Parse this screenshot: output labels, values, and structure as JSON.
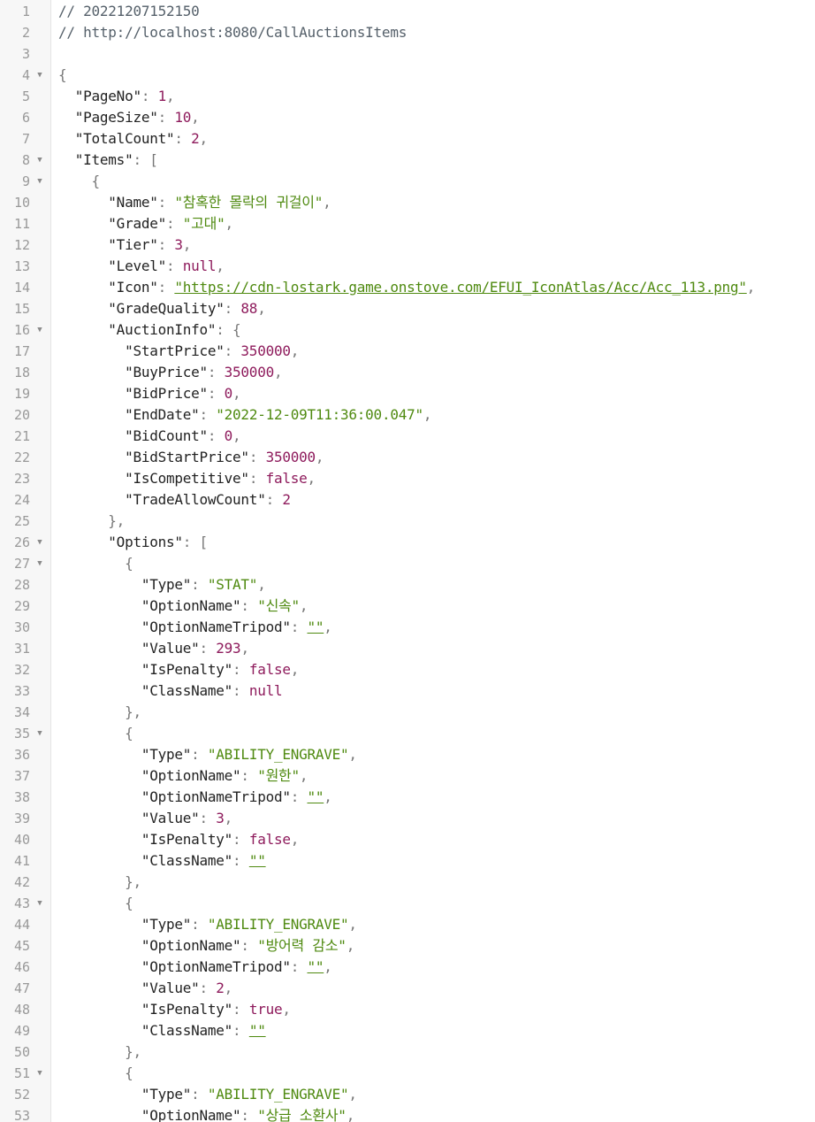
{
  "accent_colors": {
    "string": "#4f8a10",
    "number": "#8e1b5c",
    "keyword": "#8e1b5c",
    "key": "#222222",
    "punct": "#777777",
    "comment": "#55606a"
  },
  "fold_icon": "triangle-down-icon",
  "lines": [
    {
      "n": "1",
      "fold": false,
      "t": [
        {
          "c": "c",
          "v": "// 20221207152150"
        }
      ]
    },
    {
      "n": "2",
      "fold": false,
      "t": [
        {
          "c": "c",
          "v": "// http://localhost:8080/CallAuctionsItems"
        }
      ]
    },
    {
      "n": "3",
      "fold": false,
      "t": []
    },
    {
      "n": "4",
      "fold": true,
      "t": [
        {
          "c": "p",
          "v": "{"
        }
      ]
    },
    {
      "n": "5",
      "fold": false,
      "t": [
        {
          "c": "k",
          "v": "  \"PageNo\""
        },
        {
          "c": "p",
          "v": ": "
        },
        {
          "c": "n",
          "v": "1"
        },
        {
          "c": "p",
          "v": ","
        }
      ]
    },
    {
      "n": "6",
      "fold": false,
      "t": [
        {
          "c": "k",
          "v": "  \"PageSize\""
        },
        {
          "c": "p",
          "v": ": "
        },
        {
          "c": "n",
          "v": "10"
        },
        {
          "c": "p",
          "v": ","
        }
      ]
    },
    {
      "n": "7",
      "fold": false,
      "t": [
        {
          "c": "k",
          "v": "  \"TotalCount\""
        },
        {
          "c": "p",
          "v": ": "
        },
        {
          "c": "n",
          "v": "2"
        },
        {
          "c": "p",
          "v": ","
        }
      ]
    },
    {
      "n": "8",
      "fold": true,
      "t": [
        {
          "c": "k",
          "v": "  \"Items\""
        },
        {
          "c": "p",
          "v": ": ["
        }
      ]
    },
    {
      "n": "9",
      "fold": true,
      "t": [
        {
          "c": "p",
          "v": "    {"
        }
      ]
    },
    {
      "n": "10",
      "fold": false,
      "t": [
        {
          "c": "k",
          "v": "      \"Name\""
        },
        {
          "c": "p",
          "v": ": "
        },
        {
          "c": "s",
          "v": "\"참혹한 몰락의 귀걸이\""
        },
        {
          "c": "p",
          "v": ","
        }
      ]
    },
    {
      "n": "11",
      "fold": false,
      "t": [
        {
          "c": "k",
          "v": "      \"Grade\""
        },
        {
          "c": "p",
          "v": ": "
        },
        {
          "c": "s",
          "v": "\"고대\""
        },
        {
          "c": "p",
          "v": ","
        }
      ]
    },
    {
      "n": "12",
      "fold": false,
      "t": [
        {
          "c": "k",
          "v": "      \"Tier\""
        },
        {
          "c": "p",
          "v": ": "
        },
        {
          "c": "n",
          "v": "3"
        },
        {
          "c": "p",
          "v": ","
        }
      ]
    },
    {
      "n": "13",
      "fold": false,
      "t": [
        {
          "c": "k",
          "v": "      \"Level\""
        },
        {
          "c": "p",
          "v": ": "
        },
        {
          "c": "kw",
          "v": "null"
        },
        {
          "c": "p",
          "v": ","
        }
      ]
    },
    {
      "n": "14",
      "fold": false,
      "t": [
        {
          "c": "k",
          "v": "      \"Icon\""
        },
        {
          "c": "p",
          "v": ": "
        },
        {
          "c": "u",
          "v": "\"https://cdn-lostark.game.onstove.com/EFUI_IconAtlas/Acc/Acc_113.png\""
        },
        {
          "c": "p",
          "v": ","
        }
      ]
    },
    {
      "n": "15",
      "fold": false,
      "t": [
        {
          "c": "k",
          "v": "      \"GradeQuality\""
        },
        {
          "c": "p",
          "v": ": "
        },
        {
          "c": "n",
          "v": "88"
        },
        {
          "c": "p",
          "v": ","
        }
      ]
    },
    {
      "n": "16",
      "fold": true,
      "t": [
        {
          "c": "k",
          "v": "      \"AuctionInfo\""
        },
        {
          "c": "p",
          "v": ": {"
        }
      ]
    },
    {
      "n": "17",
      "fold": false,
      "t": [
        {
          "c": "k",
          "v": "        \"StartPrice\""
        },
        {
          "c": "p",
          "v": ": "
        },
        {
          "c": "n",
          "v": "350000"
        },
        {
          "c": "p",
          "v": ","
        }
      ]
    },
    {
      "n": "18",
      "fold": false,
      "t": [
        {
          "c": "k",
          "v": "        \"BuyPrice\""
        },
        {
          "c": "p",
          "v": ": "
        },
        {
          "c": "n",
          "v": "350000"
        },
        {
          "c": "p",
          "v": ","
        }
      ]
    },
    {
      "n": "19",
      "fold": false,
      "t": [
        {
          "c": "k",
          "v": "        \"BidPrice\""
        },
        {
          "c": "p",
          "v": ": "
        },
        {
          "c": "n",
          "v": "0"
        },
        {
          "c": "p",
          "v": ","
        }
      ]
    },
    {
      "n": "20",
      "fold": false,
      "t": [
        {
          "c": "k",
          "v": "        \"EndDate\""
        },
        {
          "c": "p",
          "v": ": "
        },
        {
          "c": "s",
          "v": "\"2022-12-09T11:36:00.047\""
        },
        {
          "c": "p",
          "v": ","
        }
      ]
    },
    {
      "n": "21",
      "fold": false,
      "t": [
        {
          "c": "k",
          "v": "        \"BidCount\""
        },
        {
          "c": "p",
          "v": ": "
        },
        {
          "c": "n",
          "v": "0"
        },
        {
          "c": "p",
          "v": ","
        }
      ]
    },
    {
      "n": "22",
      "fold": false,
      "t": [
        {
          "c": "k",
          "v": "        \"BidStartPrice\""
        },
        {
          "c": "p",
          "v": ": "
        },
        {
          "c": "n",
          "v": "350000"
        },
        {
          "c": "p",
          "v": ","
        }
      ]
    },
    {
      "n": "23",
      "fold": false,
      "t": [
        {
          "c": "k",
          "v": "        \"IsCompetitive\""
        },
        {
          "c": "p",
          "v": ": "
        },
        {
          "c": "kw",
          "v": "false"
        },
        {
          "c": "p",
          "v": ","
        }
      ]
    },
    {
      "n": "24",
      "fold": false,
      "t": [
        {
          "c": "k",
          "v": "        \"TradeAllowCount\""
        },
        {
          "c": "p",
          "v": ": "
        },
        {
          "c": "n",
          "v": "2"
        }
      ]
    },
    {
      "n": "25",
      "fold": false,
      "t": [
        {
          "c": "p",
          "v": "      },"
        }
      ]
    },
    {
      "n": "26",
      "fold": true,
      "t": [
        {
          "c": "k",
          "v": "      \"Options\""
        },
        {
          "c": "p",
          "v": ": ["
        }
      ]
    },
    {
      "n": "27",
      "fold": true,
      "t": [
        {
          "c": "p",
          "v": "        {"
        }
      ]
    },
    {
      "n": "28",
      "fold": false,
      "t": [
        {
          "c": "k",
          "v": "          \"Type\""
        },
        {
          "c": "p",
          "v": ": "
        },
        {
          "c": "s",
          "v": "\"STAT\""
        },
        {
          "c": "p",
          "v": ","
        }
      ]
    },
    {
      "n": "29",
      "fold": false,
      "t": [
        {
          "c": "k",
          "v": "          \"OptionName\""
        },
        {
          "c": "p",
          "v": ": "
        },
        {
          "c": "s",
          "v": "\"신속\""
        },
        {
          "c": "p",
          "v": ","
        }
      ]
    },
    {
      "n": "30",
      "fold": false,
      "t": [
        {
          "c": "k",
          "v": "          \"OptionNameTripod\""
        },
        {
          "c": "p",
          "v": ": "
        },
        {
          "c": "u",
          "v": "\"\""
        },
        {
          "c": "p",
          "v": ","
        }
      ]
    },
    {
      "n": "31",
      "fold": false,
      "t": [
        {
          "c": "k",
          "v": "          \"Value\""
        },
        {
          "c": "p",
          "v": ": "
        },
        {
          "c": "n",
          "v": "293"
        },
        {
          "c": "p",
          "v": ","
        }
      ]
    },
    {
      "n": "32",
      "fold": false,
      "t": [
        {
          "c": "k",
          "v": "          \"IsPenalty\""
        },
        {
          "c": "p",
          "v": ": "
        },
        {
          "c": "kw",
          "v": "false"
        },
        {
          "c": "p",
          "v": ","
        }
      ]
    },
    {
      "n": "33",
      "fold": false,
      "t": [
        {
          "c": "k",
          "v": "          \"ClassName\""
        },
        {
          "c": "p",
          "v": ": "
        },
        {
          "c": "kw",
          "v": "null"
        }
      ]
    },
    {
      "n": "34",
      "fold": false,
      "t": [
        {
          "c": "p",
          "v": "        },"
        }
      ]
    },
    {
      "n": "35",
      "fold": true,
      "t": [
        {
          "c": "p",
          "v": "        {"
        }
      ]
    },
    {
      "n": "36",
      "fold": false,
      "t": [
        {
          "c": "k",
          "v": "          \"Type\""
        },
        {
          "c": "p",
          "v": ": "
        },
        {
          "c": "s",
          "v": "\"ABILITY_ENGRAVE\""
        },
        {
          "c": "p",
          "v": ","
        }
      ]
    },
    {
      "n": "37",
      "fold": false,
      "t": [
        {
          "c": "k",
          "v": "          \"OptionName\""
        },
        {
          "c": "p",
          "v": ": "
        },
        {
          "c": "s",
          "v": "\"원한\""
        },
        {
          "c": "p",
          "v": ","
        }
      ]
    },
    {
      "n": "38",
      "fold": false,
      "t": [
        {
          "c": "k",
          "v": "          \"OptionNameTripod\""
        },
        {
          "c": "p",
          "v": ": "
        },
        {
          "c": "u",
          "v": "\"\""
        },
        {
          "c": "p",
          "v": ","
        }
      ]
    },
    {
      "n": "39",
      "fold": false,
      "t": [
        {
          "c": "k",
          "v": "          \"Value\""
        },
        {
          "c": "p",
          "v": ": "
        },
        {
          "c": "n",
          "v": "3"
        },
        {
          "c": "p",
          "v": ","
        }
      ]
    },
    {
      "n": "40",
      "fold": false,
      "t": [
        {
          "c": "k",
          "v": "          \"IsPenalty\""
        },
        {
          "c": "p",
          "v": ": "
        },
        {
          "c": "kw",
          "v": "false"
        },
        {
          "c": "p",
          "v": ","
        }
      ]
    },
    {
      "n": "41",
      "fold": false,
      "t": [
        {
          "c": "k",
          "v": "          \"ClassName\""
        },
        {
          "c": "p",
          "v": ": "
        },
        {
          "c": "u",
          "v": "\"\""
        }
      ]
    },
    {
      "n": "42",
      "fold": false,
      "t": [
        {
          "c": "p",
          "v": "        },"
        }
      ]
    },
    {
      "n": "43",
      "fold": true,
      "t": [
        {
          "c": "p",
          "v": "        {"
        }
      ]
    },
    {
      "n": "44",
      "fold": false,
      "t": [
        {
          "c": "k",
          "v": "          \"Type\""
        },
        {
          "c": "p",
          "v": ": "
        },
        {
          "c": "s",
          "v": "\"ABILITY_ENGRAVE\""
        },
        {
          "c": "p",
          "v": ","
        }
      ]
    },
    {
      "n": "45",
      "fold": false,
      "t": [
        {
          "c": "k",
          "v": "          \"OptionName\""
        },
        {
          "c": "p",
          "v": ": "
        },
        {
          "c": "s",
          "v": "\"방어력 감소\""
        },
        {
          "c": "p",
          "v": ","
        }
      ]
    },
    {
      "n": "46",
      "fold": false,
      "t": [
        {
          "c": "k",
          "v": "          \"OptionNameTripod\""
        },
        {
          "c": "p",
          "v": ": "
        },
        {
          "c": "u",
          "v": "\"\""
        },
        {
          "c": "p",
          "v": ","
        }
      ]
    },
    {
      "n": "47",
      "fold": false,
      "t": [
        {
          "c": "k",
          "v": "          \"Value\""
        },
        {
          "c": "p",
          "v": ": "
        },
        {
          "c": "n",
          "v": "2"
        },
        {
          "c": "p",
          "v": ","
        }
      ]
    },
    {
      "n": "48",
      "fold": false,
      "t": [
        {
          "c": "k",
          "v": "          \"IsPenalty\""
        },
        {
          "c": "p",
          "v": ": "
        },
        {
          "c": "kw",
          "v": "true"
        },
        {
          "c": "p",
          "v": ","
        }
      ]
    },
    {
      "n": "49",
      "fold": false,
      "t": [
        {
          "c": "k",
          "v": "          \"ClassName\""
        },
        {
          "c": "p",
          "v": ": "
        },
        {
          "c": "u",
          "v": "\"\""
        }
      ]
    },
    {
      "n": "50",
      "fold": false,
      "t": [
        {
          "c": "p",
          "v": "        },"
        }
      ]
    },
    {
      "n": "51",
      "fold": true,
      "t": [
        {
          "c": "p",
          "v": "        {"
        }
      ]
    },
    {
      "n": "52",
      "fold": false,
      "t": [
        {
          "c": "k",
          "v": "          \"Type\""
        },
        {
          "c": "p",
          "v": ": "
        },
        {
          "c": "s",
          "v": "\"ABILITY_ENGRAVE\""
        },
        {
          "c": "p",
          "v": ","
        }
      ]
    },
    {
      "n": "53",
      "fold": false,
      "t": [
        {
          "c": "k",
          "v": "          \"OptionName\""
        },
        {
          "c": "p",
          "v": ": "
        },
        {
          "c": "s",
          "v": "\"상급 소환사\""
        },
        {
          "c": "p",
          "v": ","
        }
      ]
    }
  ]
}
